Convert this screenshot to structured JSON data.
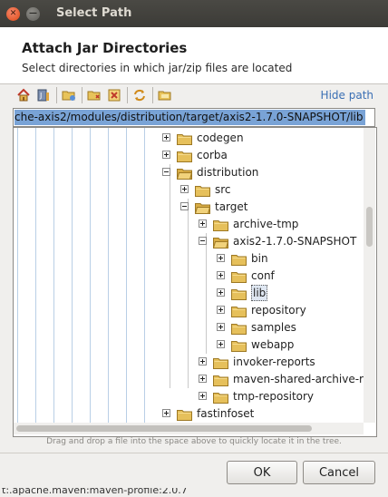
{
  "window": {
    "title": "Select Path"
  },
  "header": {
    "title": "Attach Jar Directories",
    "subtitle": "Select directories in which jar/zip files are located"
  },
  "toolbar": {
    "buttons": [
      "home-icon",
      "project-icon",
      "new-folder-icon",
      "new-folder-alt-icon",
      "delete-icon",
      "refresh-icon",
      "show-hidden-icon"
    ],
    "hide_path_label": "Hide path"
  },
  "path_field": {
    "value": "che-axis2/modules/distribution/target/axis2-1.7.0-SNAPSHOT/lib"
  },
  "tree": {
    "rows": [
      {
        "label": "codegen",
        "expanded": false,
        "selected": false
      },
      {
        "label": "corba",
        "expanded": false,
        "selected": false
      },
      {
        "label": "distribution",
        "expanded": true,
        "selected": false
      },
      {
        "label": "src",
        "expanded": false,
        "selected": false
      },
      {
        "label": "target",
        "expanded": true,
        "selected": false
      },
      {
        "label": "archive-tmp",
        "expanded": false,
        "selected": false
      },
      {
        "label": "axis2-1.7.0-SNAPSHOT",
        "expanded": true,
        "selected": false
      },
      {
        "label": "bin",
        "expanded": false,
        "selected": false
      },
      {
        "label": "conf",
        "expanded": false,
        "selected": false
      },
      {
        "label": "lib",
        "expanded": false,
        "selected": true
      },
      {
        "label": "repository",
        "expanded": false,
        "selected": false
      },
      {
        "label": "samples",
        "expanded": false,
        "selected": false
      },
      {
        "label": "webapp",
        "expanded": false,
        "selected": false
      },
      {
        "label": "invoker-reports",
        "expanded": false,
        "selected": false
      },
      {
        "label": "maven-shared-archive-resources",
        "expanded": false,
        "selected": false
      },
      {
        "label": "tmp-repository",
        "expanded": false,
        "selected": false
      },
      {
        "label": "fastinfoset",
        "expanded": false,
        "selected": false
      }
    ]
  },
  "hint": "Drag and drop a file into the space above to quickly locate it in the tree.",
  "buttons": {
    "ok": "OK",
    "cancel": "Cancel"
  },
  "status_strip": "t:.apache.maven:maven-profile:2.0.7"
}
